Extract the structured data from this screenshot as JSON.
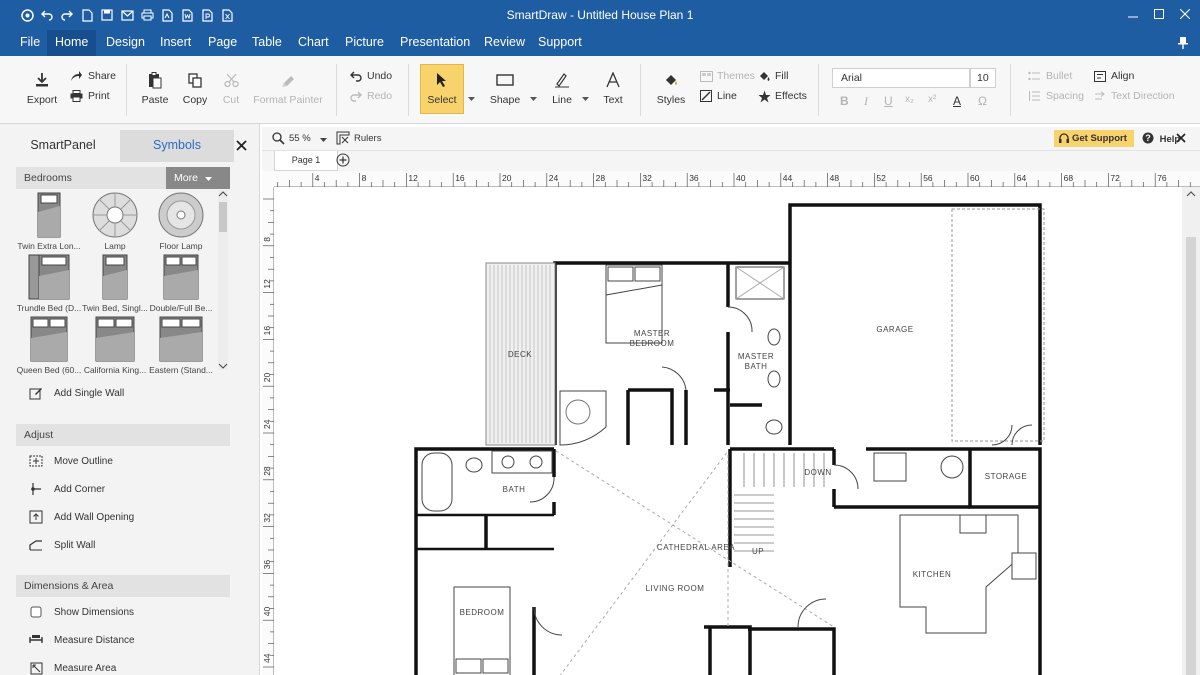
{
  "app": {
    "title": "SmartDraw - Untitled House Plan 1"
  },
  "menu": [
    "File",
    "Home",
    "Design",
    "Insert",
    "Page",
    "Table",
    "Chart",
    "Picture",
    "Presentation",
    "Review",
    "Support"
  ],
  "menu_active": "Home",
  "ribbon": {
    "export": "Export",
    "share": "Share",
    "print": "Print",
    "paste": "Paste",
    "copy": "Copy",
    "cut": "Cut",
    "format_painter": "Format Painter",
    "undo": "Undo",
    "redo": "Redo",
    "select": "Select",
    "shape": "Shape",
    "line": "Line",
    "text": "Text",
    "styles": "Styles",
    "themes": "Themes",
    "line2": "Line",
    "fill": "Fill",
    "effects": "Effects",
    "font": "Arial",
    "font_size": "10",
    "bullet": "Bullet",
    "spacing": "Spacing",
    "align": "Align",
    "text_direction": "Text Direction"
  },
  "panel": {
    "tab_smartpanel": "SmartPanel",
    "tab_symbols": "Symbols",
    "library": "Bedrooms",
    "more": "More",
    "symbols": [
      "Twin Extra Lon...",
      "Lamp",
      "Floor Lamp",
      "Trundle Bed (D...",
      "Twin Bed, Singl...",
      "Double/Full Be...",
      "Queen Bed (60...",
      "California King...",
      "Eastern (Stand..."
    ],
    "add_single_wall": "Add Single Wall",
    "adjust_header": "Adjust",
    "adjust_items": [
      "Move Outline",
      "Add Corner",
      "Add Wall Opening",
      "Split Wall"
    ],
    "dimensions_header": "Dimensions & Area",
    "dimension_items": [
      "Show Dimensions",
      "Measure Distance",
      "Measure Area"
    ]
  },
  "canvas_bar": {
    "zoom": "55 %",
    "rulers": "Rulers",
    "get_support": "Get Support",
    "help": "Help",
    "page_tab": "Page 1"
  },
  "ruler": {
    "h_labels": [
      "4",
      "8",
      "12",
      "16",
      "20",
      "24",
      "28",
      "32",
      "36",
      "40",
      "44",
      "48",
      "52",
      "56",
      "60",
      "64",
      "68",
      "72",
      "76"
    ],
    "v_labels": [
      "8",
      "12",
      "16",
      "20",
      "24",
      "28",
      "32",
      "36",
      "40",
      "44"
    ]
  },
  "plan": {
    "garage": "GARAGE",
    "deck": "DECK",
    "master_bedroom_1": "MASTER",
    "master_bedroom_2": "BEDROOM",
    "master_bath_1": "MASTER",
    "master_bath_2": "BATH",
    "bath": "BATH",
    "down": "DOWN",
    "up": "UP",
    "storage": "STORAGE",
    "cathedral_area": "CATHEDRAL AREA",
    "living_room": "LIVING ROOM",
    "kitchen": "KITCHEN",
    "bedroom": "BEDROOM"
  },
  "colors": {
    "titlebar": "#1f5da3",
    "select_highlight": "#f8d26a",
    "symbols_tab_text": "#2b6cc4"
  }
}
